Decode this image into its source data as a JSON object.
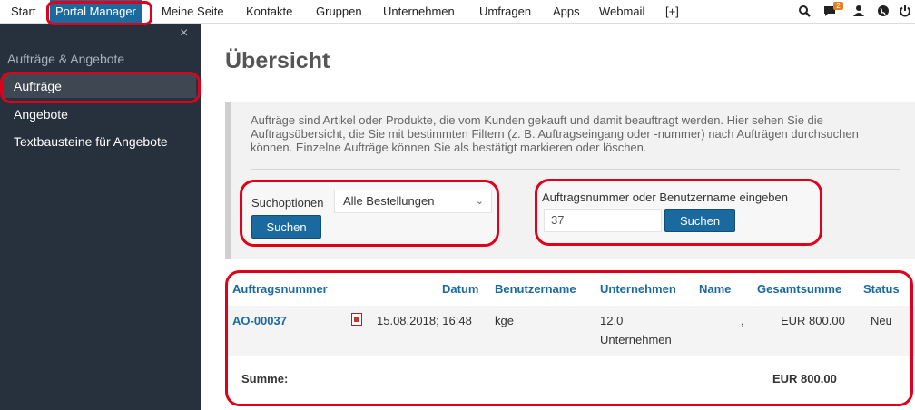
{
  "topnav": {
    "items": [
      "Start",
      "Portal Manager",
      "Meine Seite",
      "Kontakte",
      "Gruppen",
      "Unternehmen",
      "Umfragen",
      "Apps",
      "Webmail",
      "[+]"
    ],
    "icons": [
      "search-icon",
      "chat-icon",
      "user-icon",
      "globe-icon",
      "power-icon"
    ],
    "chat_badge": "2"
  },
  "sidebar": {
    "close": "×",
    "title": "Aufträge & Angebote",
    "items": [
      "Aufträge",
      "Angebote",
      "Textbausteine für Angebote"
    ]
  },
  "main": {
    "title": "Übersicht",
    "info": "Aufträge sind Artikel oder Produkte, die vom Kunden gekauft und damit beauftragt werden. Hier sehen Sie die Auftragsübersicht, die Sie mit bestimmten Filtern (z. B. Auftragseingang oder -nummer) nach Aufträgen durchsuchen können. Einzelne Aufträge können Sie als bestätigt markieren oder löschen.",
    "search": {
      "options_label": "Suchoptionen",
      "options_value": "Alle Bestellungen",
      "search_button": "Suchen",
      "number_label": "Auftragsnummer oder Benutzername eingeben",
      "number_value": "37",
      "number_button": "Suchen"
    },
    "table": {
      "headers": [
        "Auftragsnummer",
        "Datum",
        "Benutzername",
        "Unternehmen",
        "Name",
        "Gesamtsumme",
        "Status"
      ],
      "rows": [
        {
          "order": "AO-00037",
          "date": "15.08.2018; 16:48",
          "user": "kge",
          "company_line1": "12.0",
          "company_line2": "Unternehmen",
          "name": ",",
          "total": "EUR 800.00",
          "status": "Neu"
        }
      ],
      "sum_label": "Summe:",
      "sum_value": "EUR 800.00"
    }
  },
  "colors": {
    "accent": "#1a6aa0",
    "sidebar": "#26313d",
    "highlight": "#e0001a"
  }
}
